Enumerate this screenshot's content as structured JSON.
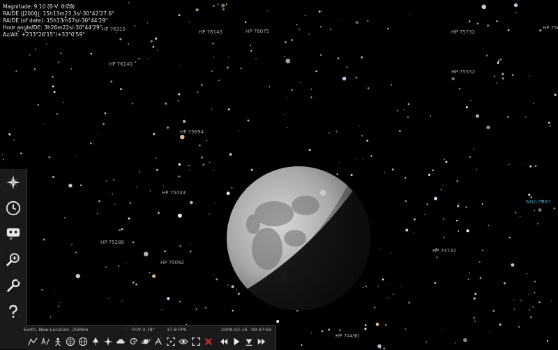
{
  "info_panel": {
    "magnitude_line": "Magnitude: 9.10 (B-V: 0.70)",
    "ra_dec_j2000": "RA/DE (J2000): 15h13m23.3s/-30°42'27.6\"",
    "ra_dec_date": "RA/DE (of date): 15h13m57s/-30°44'29\"",
    "hour_angle": "Hour angle/DE: 3h26m22s/-30°44'29\"",
    "az_alt": "Az/Alt: +233°26'15\"/+33°0'59\""
  },
  "partial_label_top": "503",
  "star_labels": [
    {
      "text": "HP 76310",
      "type": "star"
    },
    {
      "text": "HP 76143",
      "type": "star"
    },
    {
      "text": "HP 76075",
      "type": "star"
    },
    {
      "text": "HP 75732",
      "type": "star"
    },
    {
      "text": "HP 756",
      "type": "star"
    },
    {
      "text": "HP 76140",
      "type": "star"
    },
    {
      "text": "HP 75552",
      "type": "star"
    },
    {
      "text": "HP 75694",
      "type": "star"
    },
    {
      "text": "HP 75433",
      "type": "star"
    },
    {
      "text": "NGC 5897",
      "type": "ngc"
    },
    {
      "text": "HP 75288",
      "type": "star"
    },
    {
      "text": "HP 74732",
      "type": "star"
    },
    {
      "text": "HP 75092",
      "type": "star"
    },
    {
      "text": "HP 74490",
      "type": "star"
    }
  ],
  "status_bar": {
    "location": "Earth, New Location, 2509m",
    "fov": "FOV 4.78°",
    "fps": "37.8 FPS",
    "date": "2009-02-16",
    "time": "09:07:59"
  },
  "sidebar_tools": [
    "location-window",
    "date-time-window",
    "sky-viewing-options",
    "search-window",
    "configuration-window",
    "help-window"
  ],
  "colors": {
    "panel_bg": "#1c1c1e",
    "ngc_label": "#3aa7c6",
    "star_label": "#a9a9a9",
    "close_red": "#d42a2a"
  }
}
